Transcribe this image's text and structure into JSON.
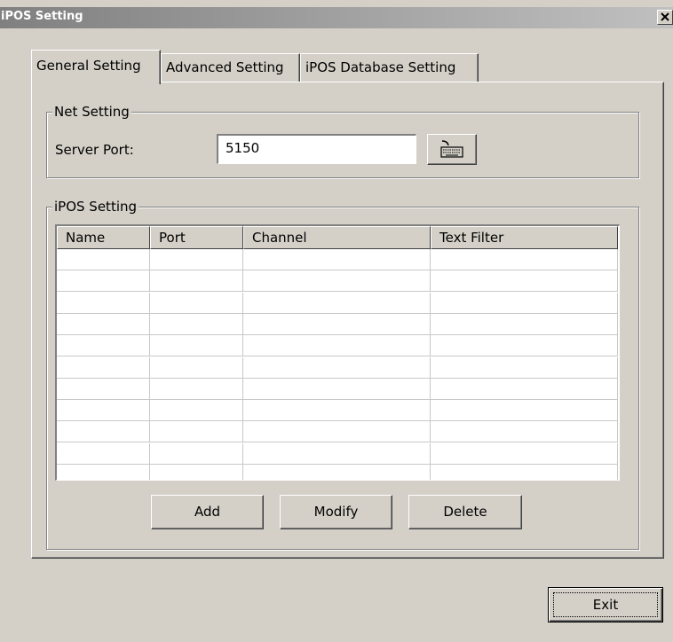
{
  "window": {
    "title": "iPOS Setting",
    "close_label": "✕"
  },
  "tabs": [
    {
      "label": "General Setting",
      "active": true
    },
    {
      "label": "Advanced Setting",
      "active": false
    },
    {
      "label": "iPOS Database Setting",
      "active": false
    }
  ],
  "net_setting": {
    "legend": "Net Setting",
    "server_port_label": "Server Port:",
    "server_port_value": "5150",
    "keyboard_icon": "keyboard-icon"
  },
  "ipos_setting": {
    "legend": "iPOS Setting",
    "columns": [
      "Name",
      "Port",
      "Channel",
      "Text Filter"
    ],
    "rows": [],
    "buttons": {
      "add": "Add",
      "modify": "Modify",
      "delete": "Delete"
    }
  },
  "footer": {
    "exit_label": "Exit"
  }
}
